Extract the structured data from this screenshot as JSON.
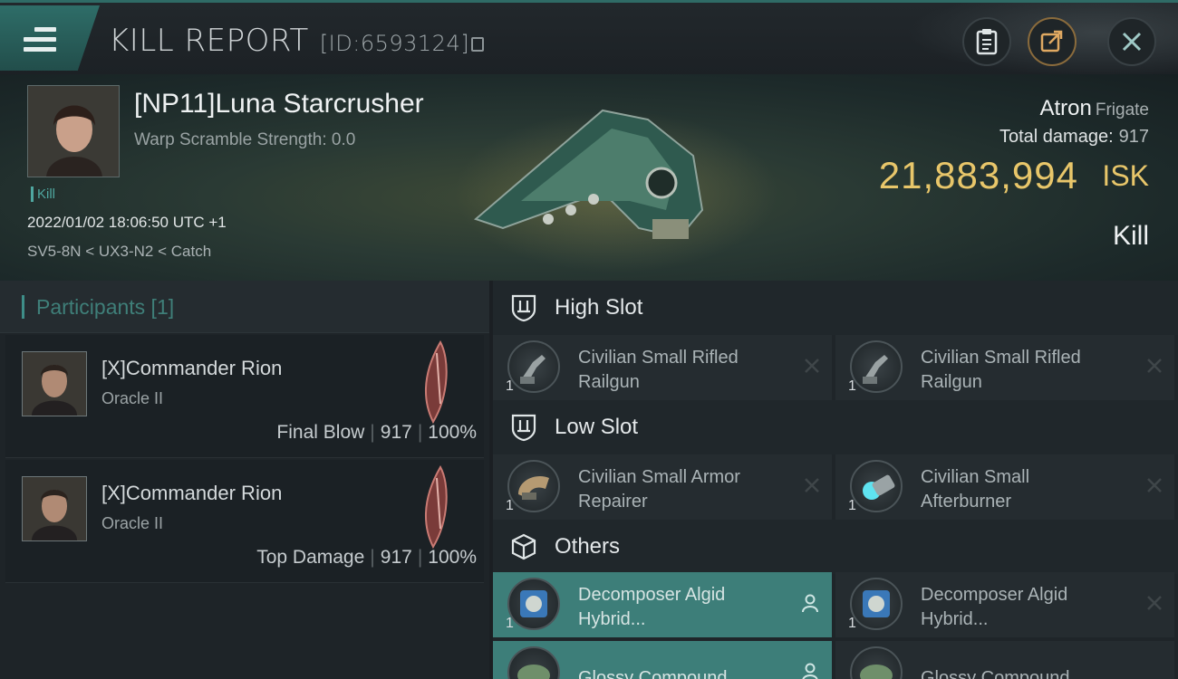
{
  "header": {
    "title": "KILL REPORT",
    "report_id": "[ID:6593124]",
    "menu_icon": "hamburger-menu-icon",
    "buttons": [
      "clipboard-icon",
      "share-icon",
      "close-icon"
    ]
  },
  "victim": {
    "name": "[NP11]Luna Starcrusher",
    "warp_scramble": "Warp Scramble Strength: 0.0",
    "kill_tag": "Kill",
    "timestamp": "2022/01/02 18:06:50 UTC +1",
    "route": "SV5-8N < UX3-N2 < Catch",
    "ship_name": "Atron",
    "ship_class": "Frigate",
    "total_damage_label": "Total damage:",
    "total_damage_value": "917",
    "isk_value": "21,883,994",
    "isk_unit": "ISK",
    "result": "Kill"
  },
  "participants": {
    "label": "Participants [1]",
    "rows": [
      {
        "name": "[X]Commander Rion",
        "ship": "Oracle II",
        "role": "Final Blow",
        "damage": "917",
        "percent": "100%"
      },
      {
        "name": "[X]Commander Rion",
        "ship": "Oracle II",
        "role": "Top Damage",
        "damage": "917",
        "percent": "100%"
      }
    ]
  },
  "fitting": {
    "high_slot": {
      "label": "High Slot",
      "items": [
        {
          "name_line1": "Civilian Small Rifled",
          "name_line2": "Railgun",
          "qty": "1"
        },
        {
          "name_line1": "Civilian Small Rifled",
          "name_line2": "Railgun",
          "qty": "1"
        }
      ]
    },
    "low_slot": {
      "label": "Low Slot",
      "items": [
        {
          "name_line1": "Civilian Small Armor",
          "name_line2": "Repairer",
          "qty": "1"
        },
        {
          "name_line1": "Civilian Small",
          "name_line2": "Afterburner",
          "qty": "1"
        }
      ]
    },
    "others": {
      "label": "Others",
      "items": [
        {
          "name_line1": "Decomposer Algid",
          "name_line2": "Hybrid...",
          "qty": "1"
        },
        {
          "name_line1": "Decomposer Algid",
          "name_line2": "Hybrid...",
          "qty": "1"
        },
        {
          "name_line1": "Glossy Compound",
          "name_line2": "",
          "qty": ""
        },
        {
          "name_line1": "Glossy Compound",
          "name_line2": "",
          "qty": ""
        }
      ]
    }
  },
  "colors": {
    "accent_teal": "#3d7e79",
    "isk_gold": "#e8c66a",
    "panel_dark": "#1e2428"
  }
}
